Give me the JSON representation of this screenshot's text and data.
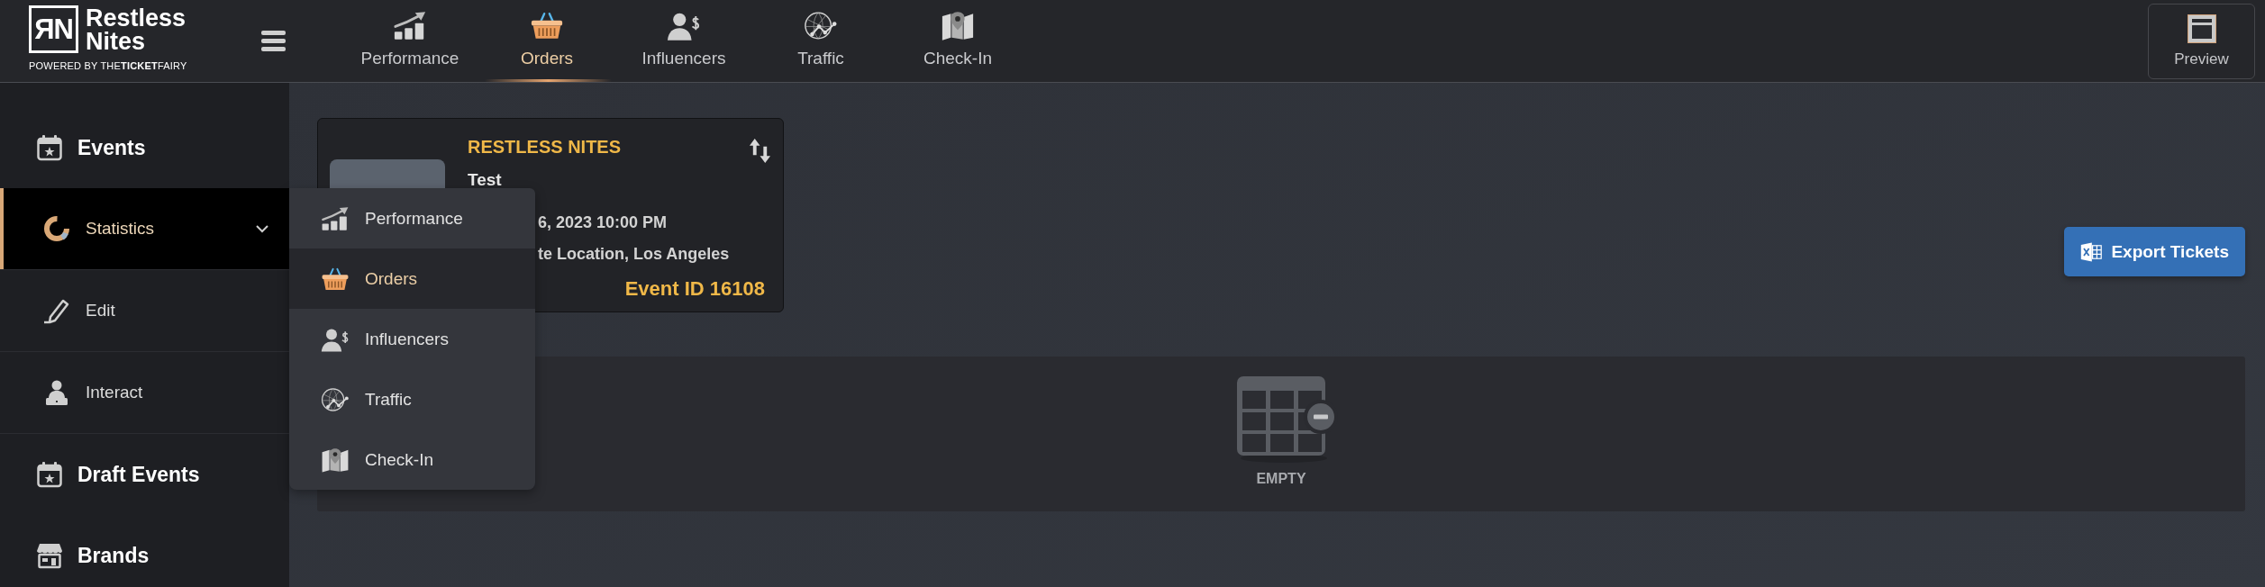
{
  "brand": {
    "logo_mark": "ЯN",
    "name_lines": [
      "Restless",
      "Nites"
    ],
    "powered_by": "POWERED BY THE**TICKET**FAIRY"
  },
  "top_nav": {
    "items": [
      {
        "label": "Performance",
        "selected": false
      },
      {
        "label": "Orders",
        "selected": true
      },
      {
        "label": "Influencers",
        "selected": false
      },
      {
        "label": "Traffic",
        "selected": false
      },
      {
        "label": "Check-In",
        "selected": false
      }
    ]
  },
  "preview_button": {
    "label": "Preview"
  },
  "sidebar": {
    "items": [
      {
        "kind": "header",
        "label": "Events",
        "selected": false
      },
      {
        "kind": "subitem",
        "label": "Statistics",
        "selected": true,
        "submenu": [
          {
            "label": "Performance",
            "selected": false
          },
          {
            "label": "Orders",
            "selected": true
          },
          {
            "label": "Influencers",
            "selected": false
          },
          {
            "label": "Traffic",
            "selected": false
          },
          {
            "label": "Check-In",
            "selected": false
          }
        ]
      },
      {
        "kind": "subitem",
        "label": "Edit",
        "selected": false
      },
      {
        "kind": "subitem",
        "label": "Interact",
        "selected": false
      },
      {
        "kind": "header",
        "label": "Draft Events",
        "selected": false
      },
      {
        "kind": "header",
        "label": "Brands",
        "selected": false
      }
    ]
  },
  "event_card": {
    "brand": "RESTLESS NITES",
    "title": "Test",
    "date": "6, 2023 10:00 PM",
    "location": "te Location, Los Angeles",
    "event_id": "Event ID 16108"
  },
  "export_button": {
    "label": "Export Tickets"
  },
  "orders_table": {
    "empty_label": "EMPTY"
  }
}
